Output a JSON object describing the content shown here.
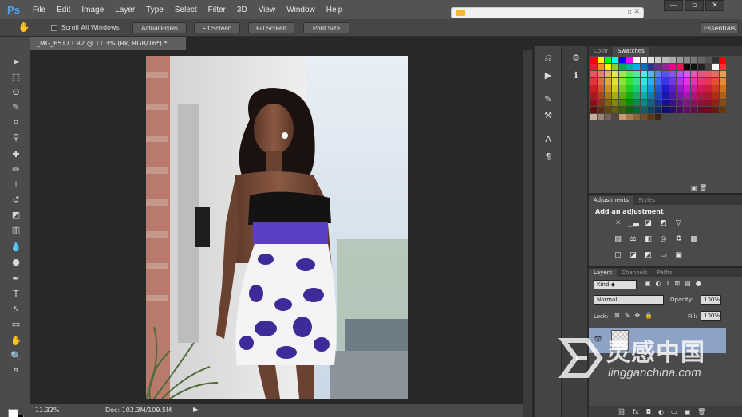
{
  "app": {
    "logo": "Ps"
  },
  "menu": [
    "File",
    "Edit",
    "Image",
    "Layer",
    "Type",
    "Select",
    "Filter",
    "3D",
    "View",
    "Window",
    "Help"
  ],
  "window_controls": [
    "—",
    "▫",
    "✕"
  ],
  "options_bar": {
    "scroll_all": "Scroll All Windows",
    "buttons": [
      "Actual Pixels",
      "Fit Screen",
      "Fill Screen",
      "Print Size"
    ],
    "workspace": "Essentials"
  },
  "document": {
    "tab_title": "_MG_6517.CR2 @ 11.3% (Rk, RGB/16*) *",
    "zoom": "11.32%",
    "doc_size": "Doc: 102.3M/109.5M"
  },
  "color_panel": {
    "tabs": [
      "Color",
      "Swatches"
    ],
    "active": "Swatches"
  },
  "adjustments_panel": {
    "tabs": [
      "Adjustments",
      "Styles"
    ],
    "title": "Add an adjustment"
  },
  "layers_panel": {
    "tabs": [
      "Layers",
      "Channels",
      "Paths"
    ],
    "kind": "Kind",
    "blend_mode": "Normal",
    "opacity_label": "Opacity:",
    "opacity": "100%",
    "lock_label": "Lock:",
    "fill_label": "Fill:",
    "fill": "100%"
  },
  "watermark": {
    "brand": "灵感中国",
    "url": "lingganchina.com"
  },
  "colors": {
    "accent": "#4fa3f7",
    "layer_selected": "#8da2c4",
    "dress_purple": "#5a3fc4"
  }
}
